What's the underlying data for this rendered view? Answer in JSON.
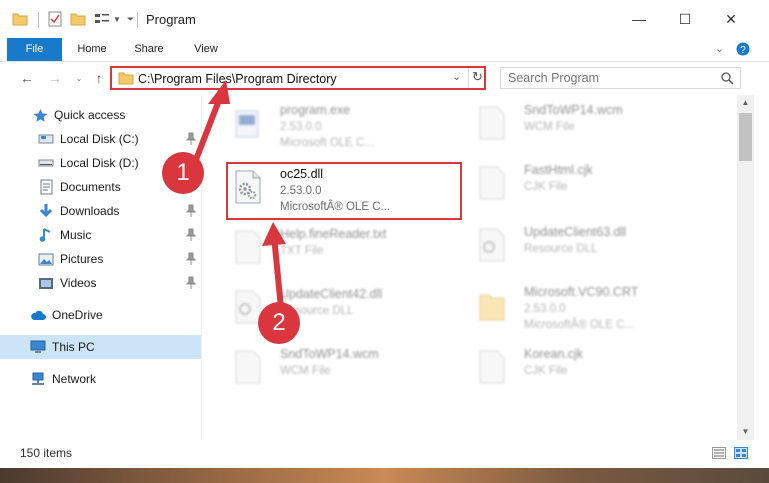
{
  "window": {
    "title": "Program",
    "controls": {
      "minimize": "—",
      "maximize": "☐",
      "close": "✕"
    }
  },
  "ribbon": {
    "tabs": [
      "File",
      "Home",
      "Share",
      "View"
    ]
  },
  "address_bar": {
    "path": "C:\\Program Files\\Program Directory"
  },
  "search": {
    "placeholder": "Search Program"
  },
  "sidebar": {
    "items": [
      {
        "label": "Quick access",
        "icon": "star-icon"
      },
      {
        "label": "Local Disk (C:)",
        "icon": "drive-icon"
      },
      {
        "label": "Local Disk (D:)",
        "icon": "drive-icon"
      },
      {
        "label": "Documents",
        "icon": "documents-icon"
      },
      {
        "label": "Downloads",
        "icon": "download-icon"
      },
      {
        "label": "Music",
        "icon": "music-icon"
      },
      {
        "label": "Pictures",
        "icon": "pictures-icon"
      },
      {
        "label": "Videos",
        "icon": "videos-icon"
      },
      {
        "label": "OneDrive",
        "icon": "cloud-icon"
      },
      {
        "label": "This PC",
        "icon": "computer-icon"
      },
      {
        "label": "Network",
        "icon": "network-icon"
      }
    ]
  },
  "files": {
    "col1": [
      {
        "name": "program.exe",
        "line1": "2.53.0.0",
        "line2": "Microsoft OLE C..."
      },
      {
        "name": "oc25.dll",
        "line1": "2.53.0.0",
        "line2": "MicrosoftÂ® OLE C..."
      },
      {
        "name": "Help.fineReader.txt",
        "line1": "TXT File",
        "line2": ""
      },
      {
        "name": "UpdateClient42.dll",
        "line1": "Resource DLL",
        "line2": ""
      },
      {
        "name": "SndToWP14.wcm",
        "line1": "WCM File",
        "line2": ""
      }
    ],
    "col2": [
      {
        "name": "SndToWP14.wcm",
        "line1": "WCM File",
        "line2": ""
      },
      {
        "name": "FastHtml.cjk",
        "line1": "CJK File",
        "line2": ""
      },
      {
        "name": "UpdateClient63.dll",
        "line1": "Resource DLL",
        "line2": ""
      },
      {
        "name": "Microsoft.VC90.CRT",
        "line1": "2.53.0.0",
        "line2": "MicrosoftÂ® OLE C..."
      },
      {
        "name": "Korean.cjk",
        "line1": "CJK File",
        "line2": ""
      }
    ]
  },
  "status": {
    "items_count": "150 items"
  },
  "annotations": {
    "step1": "1",
    "step2": "2"
  },
  "colors": {
    "accent": "#1979ca",
    "highlight": "#d9363e"
  }
}
